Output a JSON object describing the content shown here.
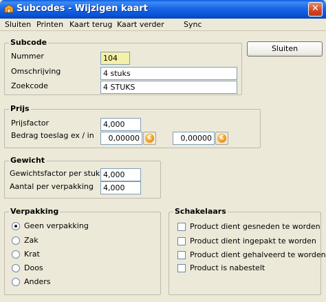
{
  "window": {
    "title": "Subcodes - Wijzigen kaart",
    "close_glyph": "✕"
  },
  "menu": [
    "Sluiten",
    "Printen",
    "Kaart terug",
    "Kaart verder",
    "Sync"
  ],
  "subcode": {
    "title": "Subcode",
    "nummer_label": "Nummer",
    "nummer_value": "104",
    "omschrijving_label": "Omschrijving",
    "omschrijving_value": "4 stuks",
    "zoekcode_label": "Zoekcode",
    "zoekcode_value": "4 STUKS"
  },
  "close_button": "Sluiten",
  "prijs": {
    "title": "Prijs",
    "prijsfactor_label": "Prijsfactor",
    "prijsfactor_value": "4,000",
    "toeslag_label": "Bedrag toeslag ex / in",
    "toeslag_ex_value": "0,00000",
    "toeslag_in_value": "0,00000",
    "euro_glyph": "€"
  },
  "gewicht": {
    "title": "Gewicht",
    "factor_label": "Gewichtsfactor per stuk",
    "factor_value": "4,000",
    "aantal_label": "Aantal per verpakking",
    "aantal_value": "4,000"
  },
  "verpakking": {
    "title": "Verpakking",
    "options": [
      "Geen verpakking",
      "Zak",
      "Krat",
      "Doos",
      "Anders"
    ],
    "selected": "Geen verpakking"
  },
  "schakelaars": {
    "title": "Schakelaars",
    "options": [
      "Product dient gesneden te worden",
      "Product dient ingepakt te worden",
      "Product dient gehalveerd te worden",
      "Product is nabestelt"
    ]
  },
  "colors": {
    "title_bar": "#0a54d6",
    "highlight_field": "#f6efa6",
    "close_button": "#d3461f"
  }
}
